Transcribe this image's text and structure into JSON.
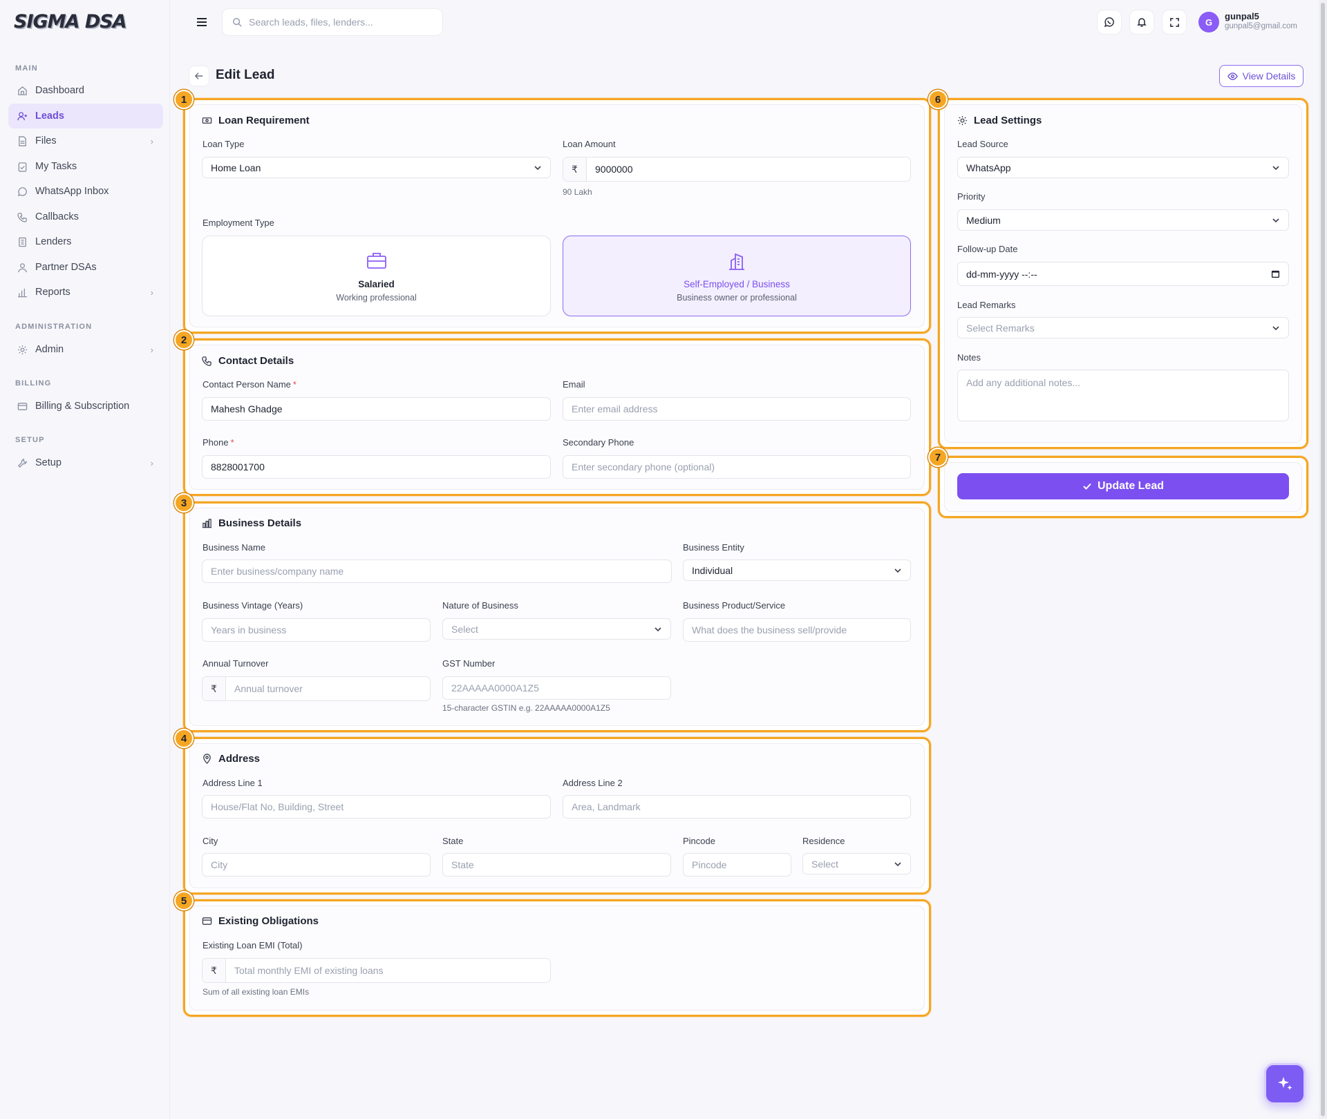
{
  "app": {
    "logo": "SIGMA DSA"
  },
  "search": {
    "placeholder": "Search leads, files, lenders..."
  },
  "user": {
    "initial": "G",
    "name": "gunpal5",
    "email": "gunpal5@gmail.com"
  },
  "sidebar": {
    "sections": {
      "main": "MAIN",
      "administration": "ADMINISTRATION",
      "billing": "BILLING",
      "setup": "SETUP"
    },
    "items": [
      {
        "label": "Dashboard",
        "icon": "home-icon"
      },
      {
        "label": "Leads",
        "icon": "user-plus-icon",
        "active": true
      },
      {
        "label": "Files",
        "icon": "file-icon"
      },
      {
        "label": "My Tasks",
        "icon": "clipboard-check-icon"
      },
      {
        "label": "WhatsApp Inbox",
        "icon": "whatsapp-icon"
      },
      {
        "label": "Callbacks",
        "icon": "phone-icon"
      },
      {
        "label": "Lenders",
        "icon": "building-icon"
      },
      {
        "label": "Partner DSAs",
        "icon": "users-icon"
      },
      {
        "label": "Reports",
        "icon": "bar-chart-icon"
      },
      {
        "label": "Admin",
        "icon": "gear-icon"
      },
      {
        "label": "Billing & Subscription",
        "icon": "card-icon"
      },
      {
        "label": "Setup",
        "icon": "wrench-icon"
      }
    ]
  },
  "page": {
    "title": "Edit Lead",
    "view_details": "View Details"
  },
  "badges": [
    "1",
    "2",
    "3",
    "4",
    "5",
    "6",
    "7"
  ],
  "loan": {
    "title": "Loan Requirement",
    "loan_type_label": "Loan Type",
    "loan_type_value": "Home Loan",
    "loan_amount_label": "Loan Amount",
    "currency": "₹",
    "loan_amount_value": "9000000",
    "loan_amount_hint": "90 Lakh",
    "employment_label": "Employment Type",
    "salaried_title": "Salaried",
    "salaried_sub": "Working professional",
    "self_title": "Self-Employed / Business",
    "self_sub": "Business owner or professional"
  },
  "contact": {
    "title": "Contact Details",
    "name_label": "Contact Person Name",
    "name_value": "Mahesh Ghadge",
    "email_label": "Email",
    "email_placeholder": "Enter email address",
    "phone_label": "Phone",
    "phone_value": "8828001700",
    "secondary_label": "Secondary Phone",
    "secondary_placeholder": "Enter secondary phone (optional)",
    "required_mark": "*"
  },
  "business": {
    "title": "Business Details",
    "name_label": "Business Name",
    "name_placeholder": "Enter business/company name",
    "entity_label": "Business Entity",
    "entity_value": "Individual",
    "vintage_label": "Business Vintage (Years)",
    "vintage_placeholder": "Years in business",
    "nature_label": "Nature of Business",
    "nature_placeholder": "Select",
    "product_label": "Business Product/Service",
    "product_placeholder": "What does the business sell/provide",
    "turnover_label": "Annual Turnover",
    "turnover_placeholder": "Annual turnover",
    "gst_label": "GST Number",
    "gst_placeholder": "22AAAAA0000A1Z5",
    "gst_hint": "15-character GSTIN e.g. 22AAAAA0000A1Z5"
  },
  "address": {
    "title": "Address",
    "line1_label": "Address Line 1",
    "line1_placeholder": "House/Flat No, Building, Street",
    "line2_label": "Address Line 2",
    "line2_placeholder": "Area, Landmark",
    "city_label": "City",
    "city_placeholder": "City",
    "state_label": "State",
    "state_placeholder": "State",
    "pincode_label": "Pincode",
    "pincode_placeholder": "Pincode",
    "residence_label": "Residence",
    "residence_placeholder": "Select"
  },
  "obligations": {
    "title": "Existing Obligations",
    "emi_label": "Existing Loan EMI (Total)",
    "emi_placeholder": "Total monthly EMI of existing loans",
    "emi_hint": "Sum of all existing loan EMIs"
  },
  "settings": {
    "title": "Lead Settings",
    "source_label": "Lead Source",
    "source_value": "WhatsApp",
    "priority_label": "Priority",
    "priority_value": "Medium",
    "followup_label": "Follow-up Date",
    "followup_value": "dd-mm-yyyy --:--",
    "remarks_label": "Lead Remarks",
    "remarks_placeholder": "Select Remarks",
    "notes_label": "Notes",
    "notes_placeholder": "Add any additional notes..."
  },
  "actions": {
    "update_label": "Update Lead"
  },
  "colors": {
    "accent": "#7c4ff0",
    "highlight": "#f5a623"
  }
}
